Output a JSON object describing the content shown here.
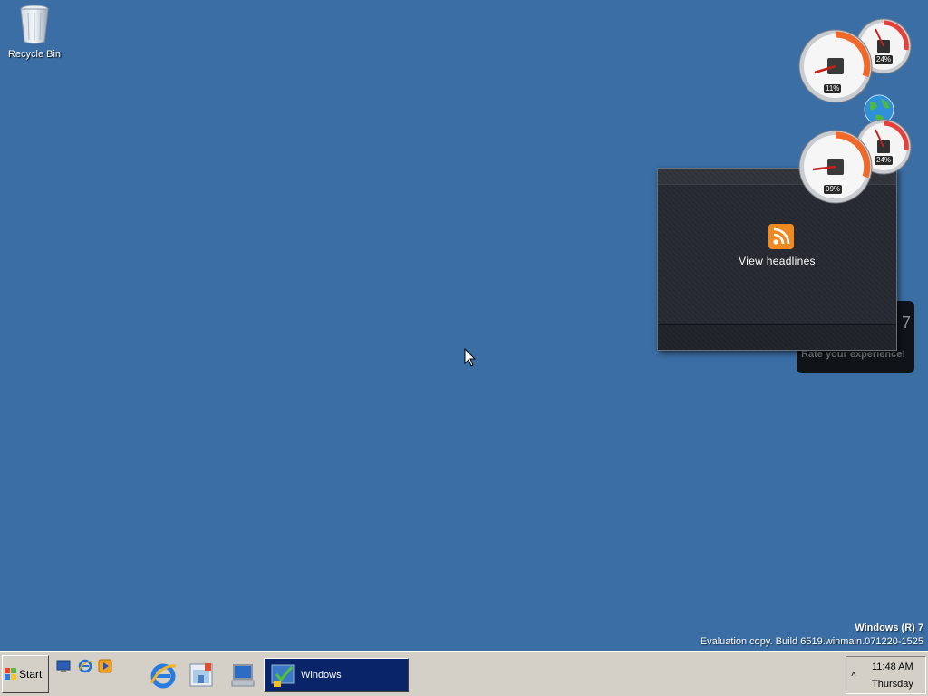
{
  "desktop": {
    "icons": [
      {
        "label": "Recycle Bin",
        "icon": "recycle-bin-icon"
      }
    ],
    "background_color": "#3a6ea5"
  },
  "watermark": {
    "title": "Windows (R) 7",
    "build": "Evaluation copy. Build 6519.winmain.071220-1525"
  },
  "gadgets": {
    "feed": {
      "label": "View headlines",
      "icon": "rss-icon"
    },
    "rate": {
      "number": "7",
      "text": "Rate your experience!"
    },
    "meters": [
      {
        "value": "11%",
        "size": "big",
        "icon": "cpu-icon"
      },
      {
        "value": "24%",
        "size": "small",
        "icon": "memory-icon"
      },
      {
        "value": "09%",
        "size": "big",
        "icon": "cpu-icon"
      },
      {
        "value": "24%",
        "size": "small",
        "icon": "memory-icon"
      }
    ],
    "globe_icon": "globe-icon"
  },
  "taskbar": {
    "start_label": "Start",
    "quick_launch": [
      "show-desktop-icon",
      "internet-explorer-icon",
      "media-player-icon"
    ],
    "pinned": [
      "internet-explorer-icon",
      "file-explorer-icon",
      "computer-icon"
    ],
    "active_task": {
      "label": "Windows",
      "icon": "windows-checklist-icon"
    },
    "clock": {
      "time": "11:48 AM",
      "day": "Thursday"
    }
  }
}
